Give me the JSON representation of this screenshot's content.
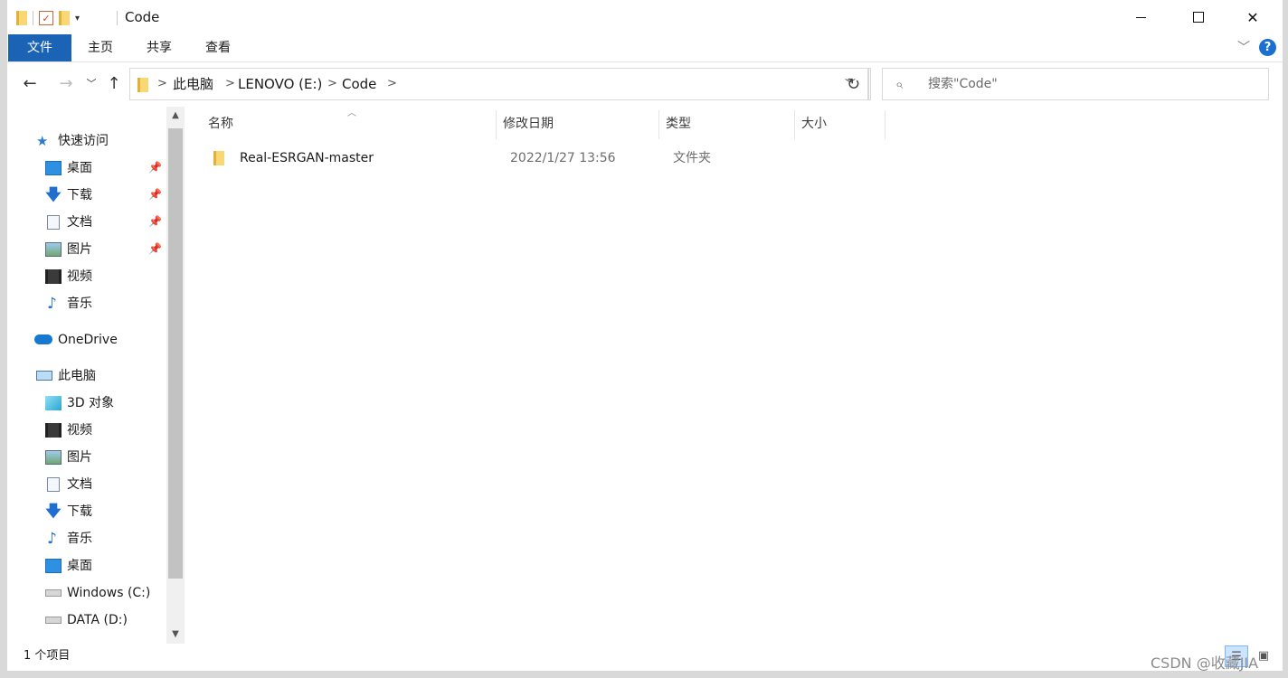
{
  "window": {
    "title": "Code"
  },
  "ribbon": {
    "tabs": [
      "文件",
      "主页",
      "共享",
      "查看"
    ]
  },
  "address": {
    "crumbs": [
      "此电脑",
      "LENOVO (E:)",
      "Code"
    ]
  },
  "search": {
    "placeholder": "搜索\"Code\""
  },
  "sidebar": {
    "quick_access": "快速访问",
    "quick_items": [
      "桌面",
      "下载",
      "文档",
      "图片",
      "视频",
      "音乐"
    ],
    "onedrive": "OneDrive",
    "this_pc": "此电脑",
    "pc_items": [
      "3D 对象",
      "视频",
      "图片",
      "文档",
      "下载",
      "音乐",
      "桌面",
      "Windows (C:)",
      "DATA (D:)"
    ]
  },
  "columns": {
    "name": "名称",
    "modified": "修改日期",
    "type": "类型",
    "size": "大小"
  },
  "files": [
    {
      "name": "Real-ESRGAN-master",
      "modified": "2022/1/27 13:56",
      "type": "文件夹"
    }
  ],
  "status": {
    "count": "1 个项目"
  },
  "watermark": "CSDN @收藏JIA"
}
